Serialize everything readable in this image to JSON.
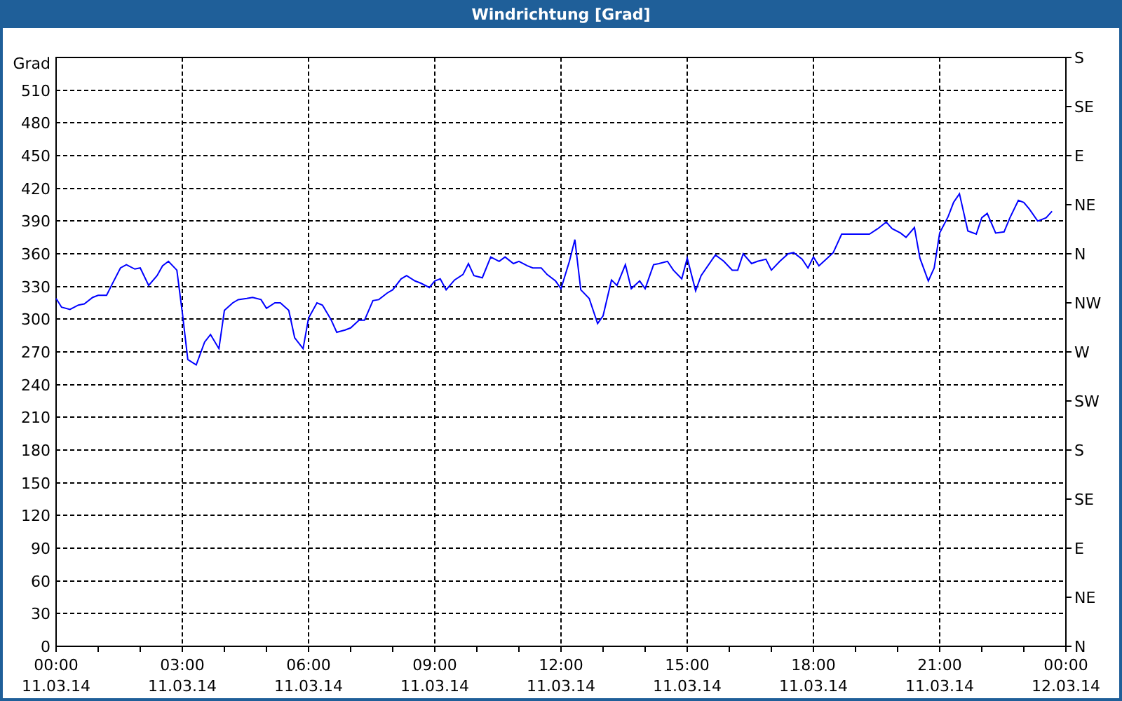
{
  "window": {
    "title": "Windrichtung [Grad]"
  },
  "chart": {
    "chart_data": {
      "type": "line",
      "grid": true,
      "ylabel": "Grad",
      "xlim": [
        0,
        24
      ],
      "ylim": [
        0,
        540
      ],
      "x": [
        0,
        0.13,
        0.33,
        0.53,
        0.67,
        0.87,
        1,
        1.2,
        1.33,
        1.53,
        1.67,
        1.87,
        2,
        2.2,
        2.4,
        2.53,
        2.67,
        2.87,
        3,
        3.13,
        3.33,
        3.53,
        3.67,
        3.87,
        4,
        4.2,
        4.33,
        4.53,
        4.67,
        4.87,
        5,
        5.2,
        5.33,
        5.53,
        5.67,
        5.87,
        6,
        6.2,
        6.33,
        6.53,
        6.67,
        6.87,
        7,
        7.2,
        7.33,
        7.53,
        7.67,
        7.87,
        8,
        8.2,
        8.33,
        8.53,
        8.67,
        8.87,
        9,
        9.13,
        9.27,
        9.47,
        9.67,
        9.8,
        9.93,
        10.13,
        10.33,
        10.53,
        10.67,
        10.87,
        11,
        11.2,
        11.33,
        11.53,
        11.67,
        11.87,
        12,
        12.2,
        12.33,
        12.47,
        12.67,
        12.87,
        13,
        13.2,
        13.33,
        13.53,
        13.67,
        13.87,
        14,
        14.2,
        14.33,
        14.53,
        14.67,
        14.87,
        15,
        15.2,
        15.33,
        15.67,
        15.87,
        16.07,
        16.2,
        16.33,
        16.53,
        16.67,
        16.87,
        17,
        17.2,
        17.4,
        17.53,
        17.73,
        17.87,
        18,
        18.13,
        18.33,
        18.47,
        18.67,
        18.87,
        19.33,
        19.53,
        19.73,
        19.87,
        20.07,
        20.2,
        20.4,
        20.53,
        20.73,
        20.87,
        21,
        21.2,
        21.33,
        21.47,
        21.67,
        21.87,
        22,
        22.13,
        22.33,
        22.53,
        22.67,
        22.87,
        23,
        23.13,
        23.33,
        23.53,
        23.67
      ],
      "series": [
        {
          "color": "#0000ff",
          "values": [
            319,
            311,
            309,
            313,
            314,
            320,
            322,
            322,
            332,
            347,
            350,
            346,
            347,
            331,
            340,
            349,
            353,
            345,
            306,
            263,
            258,
            279,
            286,
            273,
            308,
            315,
            318,
            319,
            320,
            318,
            310,
            315,
            315,
            308,
            283,
            273,
            301,
            315,
            313,
            300,
            288,
            290,
            292,
            299,
            299,
            317,
            318,
            324,
            327,
            337,
            340,
            335,
            333,
            329,
            335,
            337,
            327,
            336,
            341,
            351,
            340,
            338,
            357,
            353,
            357,
            351,
            353,
            349,
            347,
            347,
            341,
            335,
            328,
            353,
            373,
            327,
            319,
            296,
            303,
            336,
            331,
            350,
            328,
            335,
            328,
            350,
            351,
            353,
            345,
            337,
            356,
            326,
            340,
            359,
            353,
            345,
            345,
            360,
            351,
            353,
            355,
            345,
            353,
            360,
            361,
            355,
            347,
            357,
            349,
            356,
            361,
            378,
            378,
            378,
            383,
            389,
            383,
            379,
            375,
            384,
            356,
            335,
            347,
            379,
            394,
            407,
            415,
            381,
            378,
            393,
            397,
            379,
            380,
            393,
            409,
            407,
            401,
            390,
            393,
            399
          ]
        }
      ],
      "yticks": [
        0,
        30,
        60,
        90,
        120,
        150,
        180,
        210,
        240,
        270,
        300,
        330,
        360,
        390,
        420,
        450,
        480,
        510
      ],
      "xticks": [
        {
          "value": 0,
          "label": "00:00"
        },
        {
          "value": 3,
          "label": "03:00"
        },
        {
          "value": 6,
          "label": "06:00"
        },
        {
          "value": 9,
          "label": "09:00"
        },
        {
          "value": 12,
          "label": "12:00"
        },
        {
          "value": 15,
          "label": "15:00"
        },
        {
          "value": 18,
          "label": "18:00"
        },
        {
          "value": 21,
          "label": "21:00"
        },
        {
          "value": 24,
          "label": "00:00"
        }
      ]
    },
    "x_tick_dates": [
      "11.03.14",
      "11.03.14",
      "11.03.14",
      "11.03.14",
      "11.03.14",
      "11.03.14",
      "11.03.14",
      "11.03.14",
      "12.03.14"
    ],
    "compass_labels": [
      "S",
      "SE",
      "E",
      "NE",
      "N",
      "NW",
      "W",
      "SW",
      "S",
      "SE",
      "E",
      "NE",
      "N"
    ]
  }
}
